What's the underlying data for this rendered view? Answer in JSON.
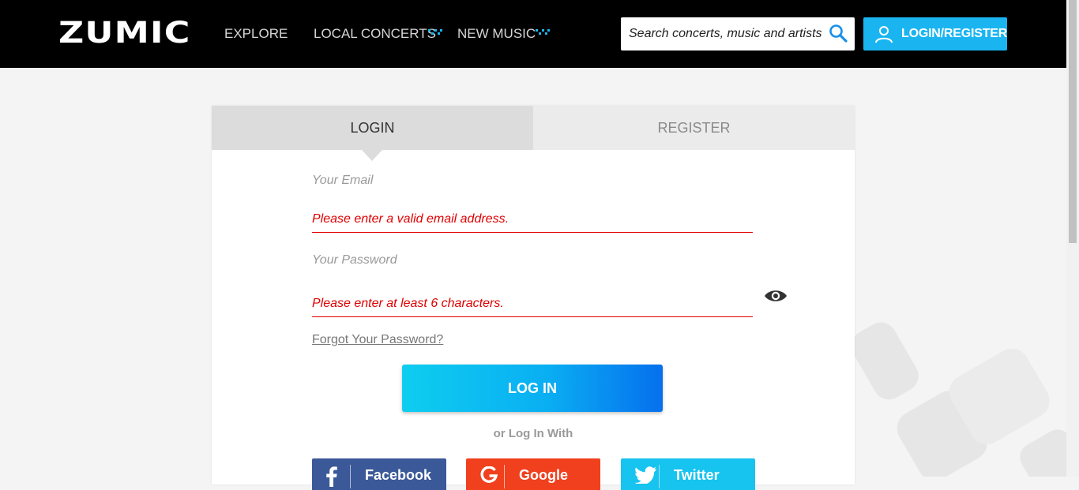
{
  "header": {
    "logo": "ZUMIC",
    "nav": [
      {
        "label": "EXPLORE"
      },
      {
        "label": "LOCAL CONCERTS"
      },
      {
        "label": "NEW MUSIC"
      }
    ],
    "search": {
      "placeholder": "Search concerts, music and artists"
    },
    "login_register": "LOGIN/REGISTER"
  },
  "tabs": {
    "login": "LOGIN",
    "register": "REGISTER"
  },
  "form": {
    "email_label": "Your Email",
    "email_error": "Please enter a valid email address.",
    "password_label": "Your Password",
    "password_error": "Please enter at least 6 characters.",
    "forgot": "Forgot Your Password?",
    "submit": "LOG IN",
    "or_text": "or Log In With"
  },
  "social": [
    {
      "label": "Facebook"
    },
    {
      "label": "Google"
    },
    {
      "label": "Twitter"
    }
  ],
  "colors": {
    "accent": "#1ab5f1",
    "error": "#e00000",
    "facebook": "#3b5998",
    "google": "#f0401e",
    "twitter": "#17c3ef"
  },
  "icons": {
    "search": "search-icon",
    "user": "user-icon",
    "eye": "eye-icon",
    "facebook": "facebook-icon",
    "google": "google-icon",
    "twitter": "twitter-icon"
  }
}
